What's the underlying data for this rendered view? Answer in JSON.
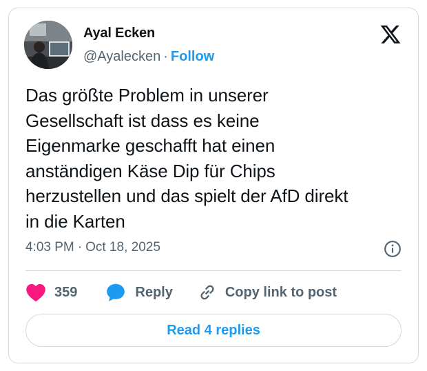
{
  "author": {
    "name": "Ayal Ecken",
    "handle": "@Ayalecken",
    "separator": "·",
    "follow_label": "Follow"
  },
  "tweet": {
    "text_lines": [
      "Das größte Problem in unserer",
      "Gesellschaft ist dass es keine",
      "Eigenmarke geschafft hat einen",
      "anständigen Käse Dip für Chips",
      "herzustellen und das spielt der AfD direkt",
      "in die Karten"
    ],
    "time": "4:03 PM",
    "separator": "·",
    "date": "Oct 18, 2025"
  },
  "actions": {
    "like_count": "359",
    "reply_label": "Reply",
    "copy_link_label": "Copy link to post"
  },
  "read_replies_label": "Read 4 replies",
  "icons": {
    "brand": "x-logo-icon",
    "info": "info-icon",
    "like": "heart-icon",
    "reply": "speech-bubble-icon",
    "copy": "link-icon"
  },
  "colors": {
    "accent": "#1d9bf0",
    "like": "#f91880",
    "muted": "#536471",
    "text": "#0f1419",
    "border": "#cfd9de"
  }
}
